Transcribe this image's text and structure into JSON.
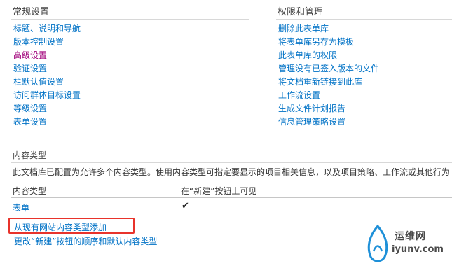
{
  "general": {
    "title": "常规设置",
    "links": [
      "标题、说明和导航",
      "版本控制设置",
      "高级设置",
      "验证设置",
      "栏默认值设置",
      "访问群体目标设置",
      "等级设置",
      "表单设置"
    ]
  },
  "permissions": {
    "title": "权限和管理",
    "links": [
      "删除此表单库",
      "将表单库另存为模板",
      "此表单库的权限",
      "管理没有已签入版本的文件",
      "将文档重新链接到此库",
      "工作流设置",
      "生成文件计划报告",
      "信息管理策略设置"
    ]
  },
  "content_types": {
    "title": "内容类型",
    "description": "此文档库已配置为允许多个内容类型。使用内容类型可指定要显示的项目相关信息，以及项目策略、工作流或其他行为",
    "columns": [
      "内容类型",
      "在“新建”按钮上可见"
    ],
    "rows": [
      {
        "name": "表单",
        "visible_mark": "✔"
      }
    ],
    "actions": [
      "从现有网站内容类型添加",
      "更改“新建”按钮的顺序和默认内容类型"
    ]
  },
  "watermark": {
    "line1": "运维网",
    "line2": "iyunv.com"
  },
  "colors": {
    "link": "#0072c6",
    "visited_link": "#a0007a",
    "highlight": "#e8332b"
  }
}
